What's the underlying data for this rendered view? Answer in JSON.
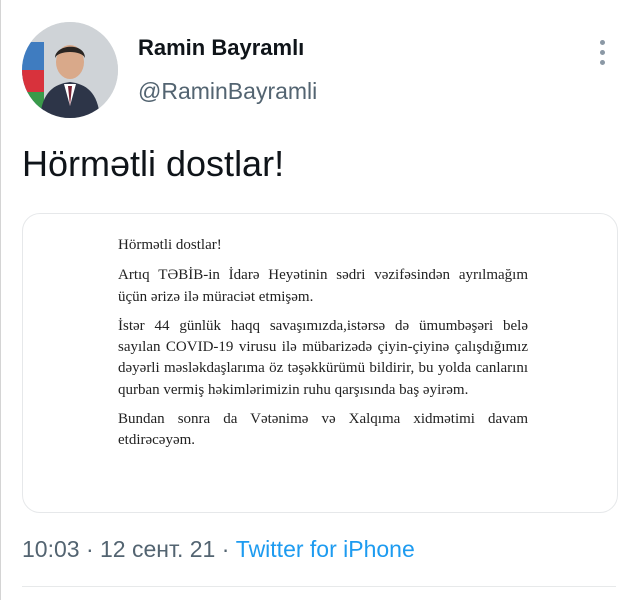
{
  "author": {
    "name": "Ramin Bayramlı",
    "handle": "@RaminBayramli"
  },
  "tweet": {
    "text": "Hörmətli dostlar!"
  },
  "letter": {
    "greeting": "Hörmətli dostlar!",
    "paragraphs": [
      "Artıq TƏBİB-in İdarə Heyətinin sədri vəzifəsindən ayrılmağım üçün ərizə ilə müraciət etmişəm.",
      "İstər 44 günlük haqq savaşımızda,istərsə də ümumbəşəri belə sayılan COVID-19 virusu ilə mübarizədə çiyin-çiyinə çalışdığımız dəyərli məsləkdaşlarıma öz təşəkkürümü bildirir, bu yolda canlarını qurban vermiş həkimlərimizin ruhu qarşısında baş əyirəm.",
      "Bundan sonra da Vətənimə və Xalqıma xidmətimi davam etdirəcəyəm."
    ]
  },
  "meta": {
    "time": "10:03",
    "separator": " · ",
    "date": "12 сент. 21",
    "source": "Twitter for iPhone"
  },
  "icons": {
    "more": "more-vertical-icon",
    "avatar": "avatar"
  },
  "colors": {
    "link": "#1d9bf0",
    "secondary_text": "#536471",
    "primary_text": "#0f1419"
  }
}
